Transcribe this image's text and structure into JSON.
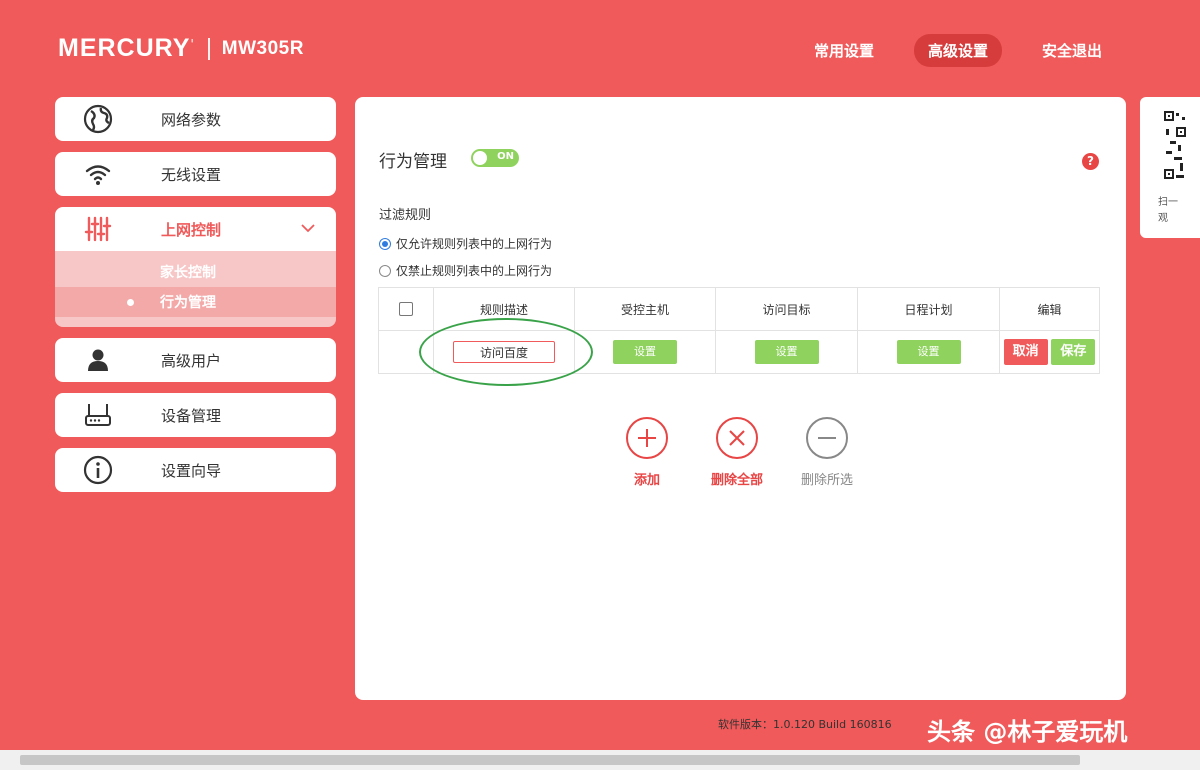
{
  "brand": {
    "logo": "MERCURY",
    "logo_mark": "'",
    "model": "MW305R"
  },
  "topnav": [
    {
      "label": "常用设置",
      "active": false
    },
    {
      "label": "高级设置",
      "active": true
    },
    {
      "label": "安全退出",
      "active": false
    }
  ],
  "sidebar": {
    "items": [
      {
        "label": "网络参数",
        "icon": "globe-icon"
      },
      {
        "label": "无线设置",
        "icon": "wifi-icon"
      },
      {
        "label": "上网控制",
        "icon": "sliders-icon",
        "expanded": true,
        "children": [
          {
            "label": "家长控制",
            "active": false
          },
          {
            "label": "行为管理",
            "active": true
          }
        ]
      },
      {
        "label": "高级用户",
        "icon": "user-icon"
      },
      {
        "label": "设备管理",
        "icon": "router-icon"
      },
      {
        "label": "设置向导",
        "icon": "info-icon"
      }
    ]
  },
  "panel": {
    "title": "行为管理",
    "toggle_text": "ON",
    "help": "?",
    "filter_label": "过滤规则",
    "radio_allow": "仅允许规则列表中的上网行为",
    "radio_deny": "仅禁止规则列表中的上网行为",
    "table": {
      "headers": [
        "规则描述",
        "受控主机",
        "访问目标",
        "日程计划",
        "编辑"
      ],
      "row": {
        "description": "访问百度",
        "host_btn": "设置",
        "target_btn": "设置",
        "schedule_btn": "设置",
        "cancel_btn": "取消",
        "save_btn": "保存"
      }
    },
    "actions": [
      {
        "label": "添加",
        "icon": "plus-circle-icon",
        "color": "#e84545"
      },
      {
        "label": "删除全部",
        "icon": "x-circle-icon",
        "color": "#e84545"
      },
      {
        "label": "删除所选",
        "icon": "minus-circle-icon",
        "color": "#888888"
      }
    ]
  },
  "qr_card": {
    "line1": "扫一",
    "line2": "观",
    "line3": "",
    "text": "扫一扫\n观"
  },
  "footer": {
    "version": "软件版本：1.0.120 Build 160816",
    "watermark": "头条 @林子爱玩机"
  },
  "colors": {
    "brand_red": "#f05a5a",
    "green": "#8fd35e",
    "radio_blue": "#2f7ce0"
  }
}
